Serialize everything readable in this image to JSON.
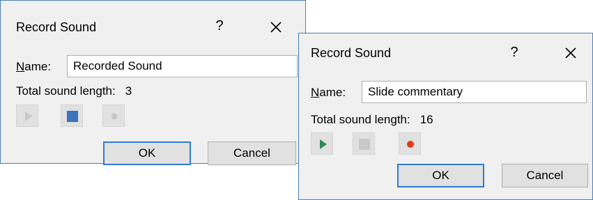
{
  "dialogs": [
    {
      "title": "Record Sound",
      "help_label": "?",
      "close_icon": "close-icon",
      "name_label_accel": "N",
      "name_label_rest": "ame:",
      "name_value": "Recorded Sound",
      "length_label": "Total sound length:",
      "length_value": "3",
      "controls": {
        "play": {
          "icon": "play-icon",
          "enabled": false
        },
        "stop": {
          "icon": "stop-icon",
          "enabled": true
        },
        "record": {
          "icon": "record-icon",
          "enabled": false
        }
      },
      "ok_label": "OK",
      "cancel_label": "Cancel"
    },
    {
      "title": "Record Sound",
      "help_label": "?",
      "close_icon": "close-icon",
      "name_label_accel": "N",
      "name_label_rest": "ame:",
      "name_value": "Slide commentary",
      "length_label": "Total sound length:",
      "length_value": "16",
      "controls": {
        "play": {
          "icon": "play-icon",
          "enabled": true
        },
        "stop": {
          "icon": "stop-icon",
          "enabled": false
        },
        "record": {
          "icon": "record-icon",
          "enabled": true
        }
      },
      "ok_label": "OK",
      "cancel_label": "Cancel"
    }
  ],
  "colors": {
    "dialog_bg": "#f0f0f0",
    "border": "#4a7fb5",
    "default_button_border": "#2e7bcf",
    "stop_active": "#3b74b8",
    "play_active": "#2e8a57",
    "record_active": "#e2391b",
    "disabled_glyph": "#c8c8c8"
  }
}
